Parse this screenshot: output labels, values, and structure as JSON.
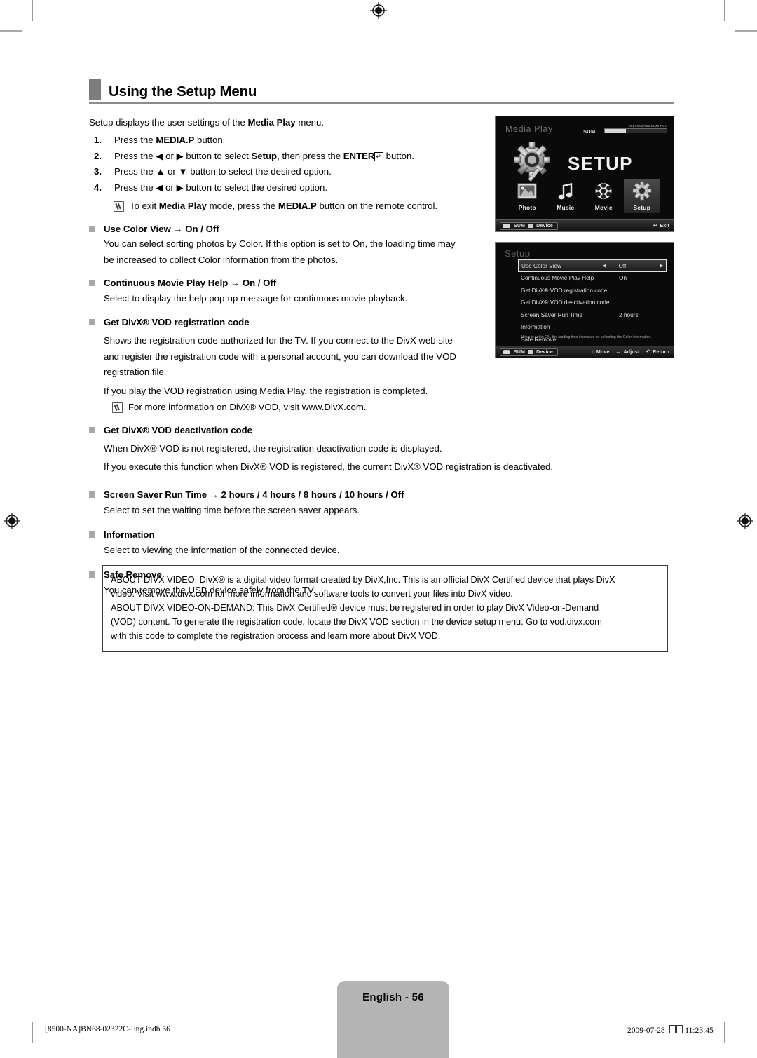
{
  "heading": {
    "title": "Using the Setup Menu"
  },
  "intro": {
    "pre": "Setup displays the user settings of the ",
    "bold": "Media Play",
    "post": " menu."
  },
  "steps": [
    {
      "num": "1.",
      "html_text": "Press the MEDIA.P button."
    },
    {
      "num": "2.",
      "html_text": "Press the ◄ or ► button to select Setup, then press the ENTER⏎ button."
    },
    {
      "num": "3.",
      "html_text": "Press the ▲ or ▼ button to select the desired option."
    },
    {
      "num": "4.",
      "html_text": "Press the ◄ or ► button to select the desired option."
    }
  ],
  "exit_note": "To exit Media Play mode, press the MEDIA.P button on the remote control.",
  "sections": [
    {
      "title": "Use Color View → On / Off",
      "lines": [
        "You can select sorting photos by Color. If this option is set to On, the loading time may",
        "be increased to collect Color information from the photos."
      ]
    },
    {
      "title": "Continuous Movie Play Help → On / Off",
      "lines": [
        "Select to display the help pop-up message for continuous movie playback."
      ]
    },
    {
      "title": "Get DivX® VOD registration code",
      "lines": [
        "Shows the registration code authorized for the TV. If you connect to the DivX web site",
        "and register the registration code with a personal account, you can download the VOD",
        "registration file.",
        "If you play the VOD registration using Media Play, the registration is completed."
      ],
      "note": "For more information on DivX® VOD, visit www.DivX.com."
    },
    {
      "title": "Get DivX® VOD deactivation code",
      "lines": [
        "When DivX® VOD is not registered, the registration deactivation code is displayed.",
        "If you execute this function when DivX® VOD is registered, the current DivX® VOD registration is deactivated."
      ]
    },
    {
      "title": "Screen Saver Run Time → 2 hours / 4 hours / 8 hours / 10 hours / Off",
      "lines": [
        "Select to set the waiting time before the screen saver appears."
      ]
    },
    {
      "title": "Information",
      "lines": [
        "Select to viewing the information of the connected device."
      ]
    },
    {
      "title": "Safe Remove",
      "lines": [
        "You can remove the USB device safely from the TV."
      ]
    }
  ],
  "tv_media_play": {
    "title": "Media Play",
    "storage_label": "SUM",
    "storage_capacity": "851.26MB/982.60MB Free",
    "setup_word": "SETUP",
    "icons": [
      {
        "label": "Photo",
        "icon": "photo-icon",
        "selected": false
      },
      {
        "label": "Music",
        "icon": "music-note-icon",
        "selected": false
      },
      {
        "label": "Movie",
        "icon": "film-reel-icon",
        "selected": false
      },
      {
        "label": "Setup",
        "icon": "gear-icon",
        "selected": true
      }
    ],
    "bottom_bar": {
      "source_label": "SUM",
      "device_label": "Device",
      "exit_label": "Exit"
    }
  },
  "tv_setup_menu": {
    "title": "Setup",
    "rows": [
      {
        "name": "Use Color View",
        "value": "Off",
        "highlighted": true,
        "has_arrows": true
      },
      {
        "name": "Continuous Movie Play Help",
        "value": "On",
        "highlighted": false,
        "has_arrows": false
      },
      {
        "name": "Get DivX® VOD registration code",
        "value": "",
        "highlighted": false,
        "has_arrows": false
      },
      {
        "name": "Get DivX® VOD deactivation code",
        "value": "",
        "highlighted": false,
        "has_arrows": false
      },
      {
        "name": "Screen Saver Run Time",
        "value": "2 hours",
        "highlighted": false,
        "has_arrows": false
      },
      {
        "name": "Information",
        "value": "",
        "highlighted": false,
        "has_arrows": false
      },
      {
        "name": "Safe Remove",
        "value": "",
        "highlighted": false,
        "has_arrows": false
      }
    ],
    "help_text": "If this is set to ON, the leading time increases for collecting the Color information.",
    "bottom_bar": {
      "source_label": "SUM",
      "device_label": "Device",
      "move_label": "Move",
      "adjust_label": "Adjust",
      "return_label": "Return"
    }
  },
  "divx_box": {
    "lines": [
      "ABOUT DIVX VIDEO: DivX® is a digital video format created by DivX,Inc. This is an official DivX Certified device that plays DivX",
      "video. Visit www.divx.com for more information and software tools to convert your files into DivX video.",
      "ABOUT DIVX VIDEO-ON-DEMAND: This DivX Certified® device must be registered in order to play DivX Video-on-Demand",
      "(VOD) content. To generate the registration code, locate the DivX VOD section in the device setup menu. Go to vod.divx.com",
      "with this code to complete the registration process and learn more about DivX VOD."
    ]
  },
  "footer": {
    "page_label": "English - 56",
    "file_info": "[8500-NA]BN68-02322C-Eng.indb   56",
    "date": "2009-07-28",
    "time": "11:23:45"
  },
  "colors": {
    "heading_marker": "#7d7d7d",
    "bullet": "#a9a9a9",
    "footer_tab": "#b4b4b4",
    "rule": "#8c8c8c"
  }
}
